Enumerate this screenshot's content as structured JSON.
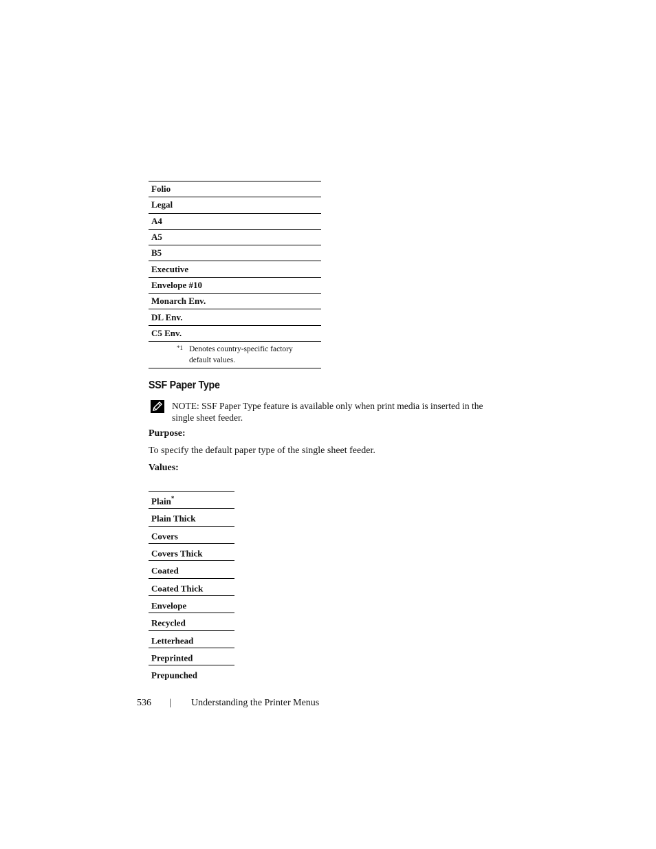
{
  "paper_size_table": {
    "rows": [
      "Folio",
      "Legal",
      "A4",
      "A5",
      "B5",
      "Executive",
      "Envelope #10",
      "Monarch Env.",
      "DL Env.",
      "C5 Env."
    ],
    "footnote_mark": "*1",
    "footnote_text": "Denotes country-specific factory default values."
  },
  "section": {
    "title": "SSF Paper Type",
    "note_icon": "pencil-note-icon",
    "note": "NOTE: SSF Paper Type feature is available only when print media is inserted in the single sheet feeder.",
    "purpose_label": "Purpose:",
    "purpose_text": "To specify the default paper type of the single sheet feeder.",
    "values_label": "Values:"
  },
  "paper_type_table": {
    "rows": [
      {
        "label": "Plain",
        "mark": "*"
      },
      {
        "label": "Plain Thick",
        "mark": ""
      },
      {
        "label": "Covers",
        "mark": ""
      },
      {
        "label": "Covers Thick",
        "mark": ""
      },
      {
        "label": "Coated",
        "mark": ""
      },
      {
        "label": "Coated Thick",
        "mark": ""
      },
      {
        "label": "Envelope",
        "mark": ""
      },
      {
        "label": "Recycled",
        "mark": ""
      },
      {
        "label": "Letterhead",
        "mark": ""
      },
      {
        "label": "Preprinted",
        "mark": ""
      },
      {
        "label": "Prepunched",
        "mark": ""
      }
    ]
  },
  "footer": {
    "page_number": "536",
    "separator": "|",
    "chapter": "Understanding the Printer Menus"
  }
}
